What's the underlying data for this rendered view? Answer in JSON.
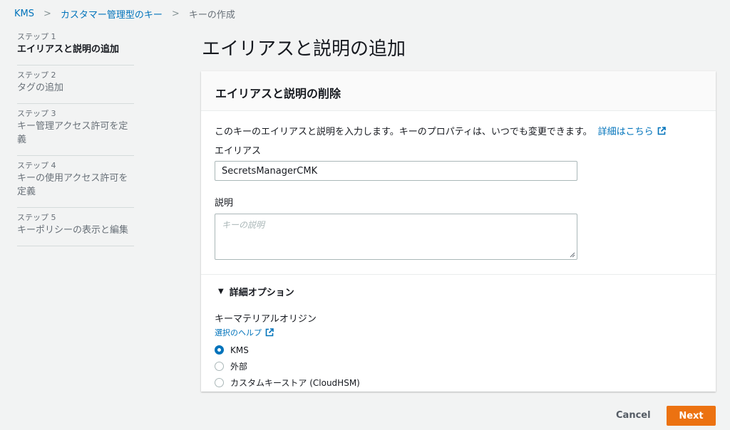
{
  "breadcrumb": [
    {
      "label": "KMS",
      "link": true
    },
    {
      "label": "カスタマー管理型のキー",
      "link": true
    },
    {
      "label": "キーの作成",
      "link": false
    }
  ],
  "steps": [
    {
      "num": "ステップ 1",
      "label": "エイリアスと説明の追加",
      "active": true
    },
    {
      "num": "ステップ 2",
      "label": "タグの追加",
      "active": false
    },
    {
      "num": "ステップ 3",
      "label": "キー管理アクセス許可を定義",
      "active": false
    },
    {
      "num": "ステップ 4",
      "label": "キーの使用アクセス許可を定義",
      "active": false
    },
    {
      "num": "ステップ 5",
      "label": "キーポリシーの表示と編集",
      "active": false
    }
  ],
  "page_title": "エイリアスと説明の追加",
  "panel": {
    "header": "エイリアスと説明の削除",
    "description": "このキーのエイリアスと説明を入力します。キーのプロパティは、いつでも変更できます。",
    "learn_more": "詳細はこちら",
    "alias_label": "エイリアス",
    "alias_value": "SecretsManagerCMK",
    "desc_label": "説明",
    "desc_placeholder": "キーの説明",
    "advanced_label": "詳細オプション",
    "origin_label": "キーマテリアルオリジン",
    "help_link": "選択のヘルプ",
    "options": [
      {
        "label": "KMS",
        "checked": true
      },
      {
        "label": "外部",
        "checked": false
      },
      {
        "label": "カスタムキーストア (CloudHSM)",
        "checked": false
      }
    ]
  },
  "footer": {
    "cancel": "Cancel",
    "next": "Next"
  },
  "colors": {
    "link": "#0073bb",
    "primary_button": "#ec7211",
    "background": "#f2f3f3"
  }
}
